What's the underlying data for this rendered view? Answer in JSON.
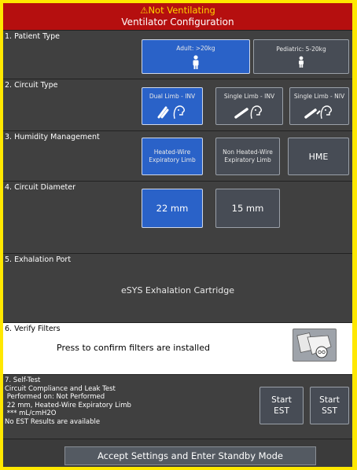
{
  "header": {
    "alarm": "⚠Not Ventilating",
    "title": "Ventilator Configuration"
  },
  "patient_type": {
    "label": "1. Patient Type",
    "options": [
      {
        "label": "Adult: >20kg",
        "selected": true,
        "icon": "adult-patient-icon"
      },
      {
        "label": "Pediatric: 5-20kg",
        "selected": false,
        "icon": "pediatric-patient-icon"
      }
    ]
  },
  "circuit_type": {
    "label": "2. Circuit Type",
    "options": [
      {
        "label": "Dual Limb - INV",
        "selected": true,
        "icon": "dual-limb-icon"
      },
      {
        "label": "Single Limb - INV",
        "selected": false,
        "icon": "single-limb-inv-icon"
      },
      {
        "label": "Single Limb - NIV",
        "selected": false,
        "icon": "single-limb-niv-icon"
      }
    ]
  },
  "humidity": {
    "label": "3. Humidity Management",
    "options": [
      {
        "line1": "Heated-Wire",
        "line2": "Expiratory Limb",
        "selected": true
      },
      {
        "line1": "Non Heated-Wire",
        "line2": "Expiratory Limb",
        "selected": false
      },
      {
        "line1": "HME",
        "line2": "",
        "selected": false
      }
    ]
  },
  "diameter": {
    "label": "4. Circuit Diameter",
    "options": [
      {
        "label": "22 mm",
        "selected": true
      },
      {
        "label": "15 mm",
        "selected": false
      }
    ]
  },
  "exhalation_port": {
    "label": "5. Exhalation Port",
    "value": "eSYS Exhalation Cartridge"
  },
  "verify_filters": {
    "label": "6. Verify Filters",
    "text": "Press to confirm filters are installed",
    "icon": "filter-icon"
  },
  "self_test": {
    "label": "7. Self-Test",
    "lines": [
      "Circuit Compliance and Leak Test",
      " Performed on: Not Performed",
      " 22 mm, Heated-Wire Expiratory Limb",
      " *** mL/cmH2O",
      "No EST Results are available"
    ],
    "est": {
      "line1": "Start",
      "line2": "EST"
    },
    "sst": {
      "line1": "Start",
      "line2": "SST"
    }
  },
  "accept_label": "Accept Settings and Enter Standby Mode",
  "colors": {
    "frame": "#ffe800",
    "header": "#b50f0f",
    "selected": "#2a62c8",
    "unselected": "#474c55"
  }
}
